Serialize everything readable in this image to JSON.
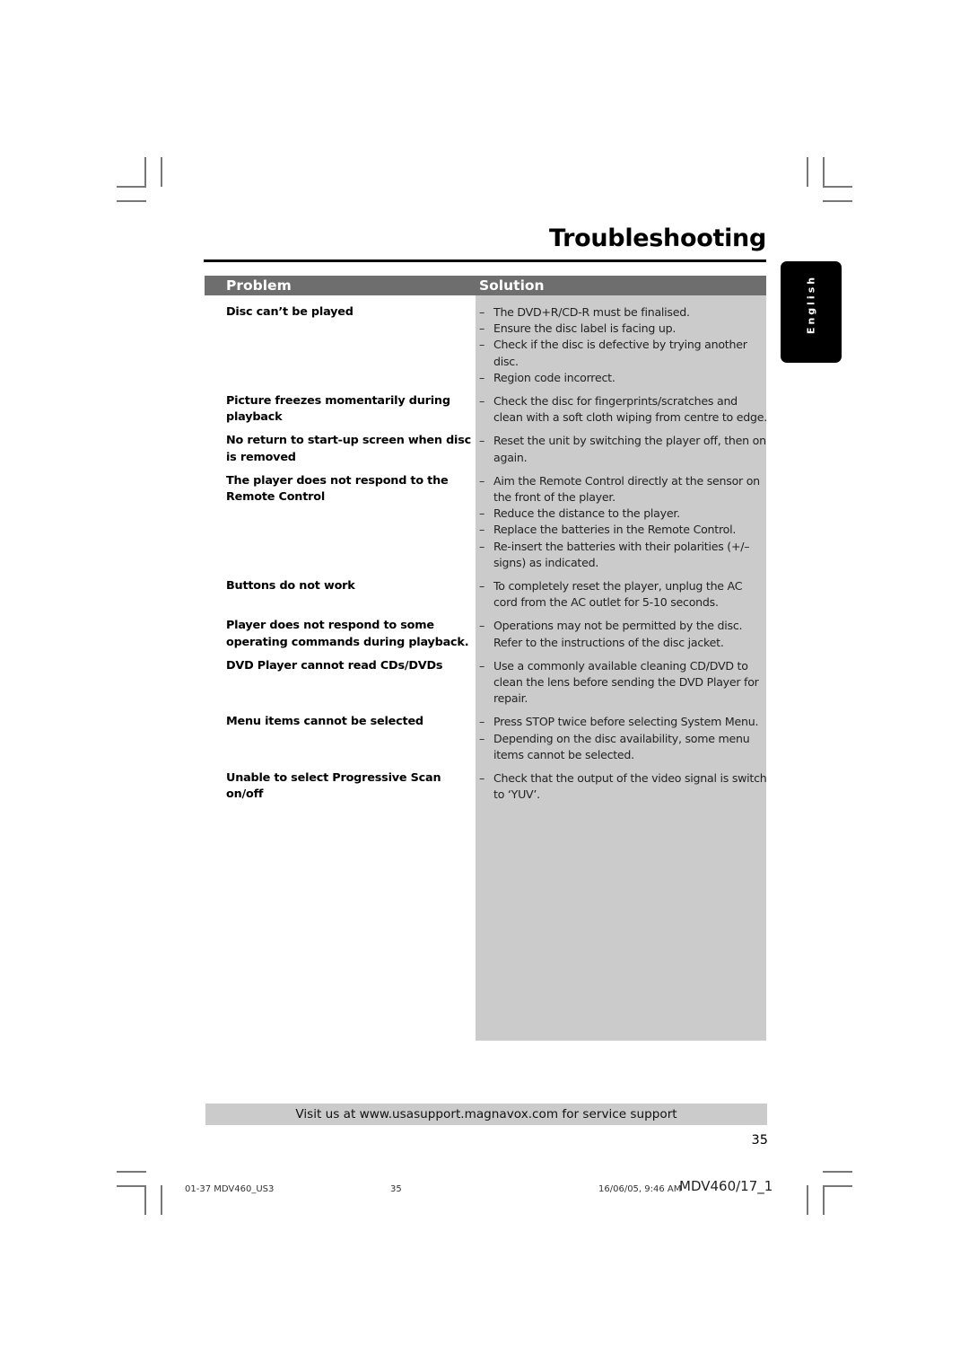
{
  "page": {
    "title": "Troubleshooting",
    "language_tab": "English",
    "table": {
      "headers": {
        "problem": "Problem",
        "solution": "Solution"
      },
      "rows": [
        {
          "problem": "Disc can’t be played",
          "solutions": [
            "The DVD+R/CD-R must be finalised.",
            "Ensure the disc label is facing up.",
            "Check if the disc is defective by trying another disc.",
            "Region code incorrect."
          ]
        },
        {
          "problem": "Picture freezes momentarily during playback",
          "solutions": [
            "Check the disc for fingerprints/scratches and clean with a soft cloth wiping from centre to edge."
          ]
        },
        {
          "problem": "No return to start-up screen when disc is removed",
          "solutions": [
            "Reset the unit by switching the player off, then on again."
          ]
        },
        {
          "problem": "The player does not respond to the Remote Control",
          "solutions": [
            "Aim the Remote Control directly at the sensor on the front of the player.",
            "Reduce the distance to the player.",
            "Replace the batteries in the Remote Control.",
            "Re-insert the batteries with their polarities (+/– signs) as indicated."
          ]
        },
        {
          "problem": "Buttons do not work",
          "solutions": [
            "To completely reset the player, unplug the AC cord from the AC outlet for 5-10 seconds."
          ]
        },
        {
          "problem": "Player does not respond to some operating commands during playback.",
          "solutions": [
            "Operations may not be permitted by the disc. Refer to the instructions of the disc jacket."
          ]
        },
        {
          "problem": "DVD Player cannot read CDs/DVDs",
          "solutions": [
            "Use a commonly available cleaning CD/DVD to clean the lens before sending the DVD Player for repair."
          ]
        },
        {
          "problem": "Menu items cannot be selected",
          "solutions": [
            "Press STOP twice before selecting System Menu.",
            "Depending on the disc availability, some menu items cannot be selected."
          ]
        },
        {
          "problem": "Unable to select Progressive Scan on/off",
          "solutions": [
            "Check that the output of the video signal is switch to ‘YUV’."
          ]
        }
      ]
    },
    "support_text": "Visit us at www.usasupport.magnavox.com for service support",
    "page_number": "35",
    "footer": {
      "file": "01-37 MDV460_US3",
      "page": "35",
      "timestamp": "16/06/05, 9:46 AM",
      "model": "MDV460/17_1"
    }
  }
}
